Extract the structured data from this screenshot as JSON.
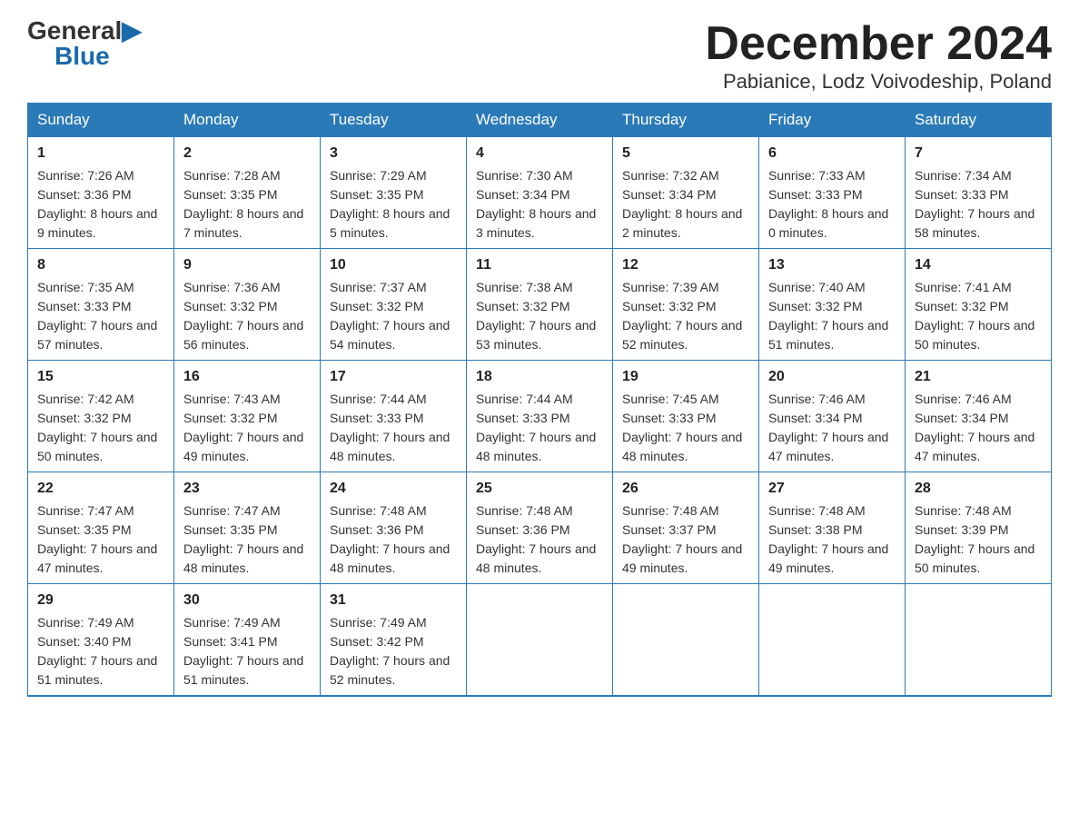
{
  "logo": {
    "general": "General",
    "blue": "Blue"
  },
  "title": "December 2024",
  "subtitle": "Pabianice, Lodz Voivodeship, Poland",
  "days": [
    "Sunday",
    "Monday",
    "Tuesday",
    "Wednesday",
    "Thursday",
    "Friday",
    "Saturday"
  ],
  "weeks": [
    [
      {
        "num": "1",
        "sunrise": "7:26 AM",
        "sunset": "3:36 PM",
        "daylight": "8 hours and 9 minutes."
      },
      {
        "num": "2",
        "sunrise": "7:28 AM",
        "sunset": "3:35 PM",
        "daylight": "8 hours and 7 minutes."
      },
      {
        "num": "3",
        "sunrise": "7:29 AM",
        "sunset": "3:35 PM",
        "daylight": "8 hours and 5 minutes."
      },
      {
        "num": "4",
        "sunrise": "7:30 AM",
        "sunset": "3:34 PM",
        "daylight": "8 hours and 3 minutes."
      },
      {
        "num": "5",
        "sunrise": "7:32 AM",
        "sunset": "3:34 PM",
        "daylight": "8 hours and 2 minutes."
      },
      {
        "num": "6",
        "sunrise": "7:33 AM",
        "sunset": "3:33 PM",
        "daylight": "8 hours and 0 minutes."
      },
      {
        "num": "7",
        "sunrise": "7:34 AM",
        "sunset": "3:33 PM",
        "daylight": "7 hours and 58 minutes."
      }
    ],
    [
      {
        "num": "8",
        "sunrise": "7:35 AM",
        "sunset": "3:33 PM",
        "daylight": "7 hours and 57 minutes."
      },
      {
        "num": "9",
        "sunrise": "7:36 AM",
        "sunset": "3:32 PM",
        "daylight": "7 hours and 56 minutes."
      },
      {
        "num": "10",
        "sunrise": "7:37 AM",
        "sunset": "3:32 PM",
        "daylight": "7 hours and 54 minutes."
      },
      {
        "num": "11",
        "sunrise": "7:38 AM",
        "sunset": "3:32 PM",
        "daylight": "7 hours and 53 minutes."
      },
      {
        "num": "12",
        "sunrise": "7:39 AM",
        "sunset": "3:32 PM",
        "daylight": "7 hours and 52 minutes."
      },
      {
        "num": "13",
        "sunrise": "7:40 AM",
        "sunset": "3:32 PM",
        "daylight": "7 hours and 51 minutes."
      },
      {
        "num": "14",
        "sunrise": "7:41 AM",
        "sunset": "3:32 PM",
        "daylight": "7 hours and 50 minutes."
      }
    ],
    [
      {
        "num": "15",
        "sunrise": "7:42 AM",
        "sunset": "3:32 PM",
        "daylight": "7 hours and 50 minutes."
      },
      {
        "num": "16",
        "sunrise": "7:43 AM",
        "sunset": "3:32 PM",
        "daylight": "7 hours and 49 minutes."
      },
      {
        "num": "17",
        "sunrise": "7:44 AM",
        "sunset": "3:33 PM",
        "daylight": "7 hours and 48 minutes."
      },
      {
        "num": "18",
        "sunrise": "7:44 AM",
        "sunset": "3:33 PM",
        "daylight": "7 hours and 48 minutes."
      },
      {
        "num": "19",
        "sunrise": "7:45 AM",
        "sunset": "3:33 PM",
        "daylight": "7 hours and 48 minutes."
      },
      {
        "num": "20",
        "sunrise": "7:46 AM",
        "sunset": "3:34 PM",
        "daylight": "7 hours and 47 minutes."
      },
      {
        "num": "21",
        "sunrise": "7:46 AM",
        "sunset": "3:34 PM",
        "daylight": "7 hours and 47 minutes."
      }
    ],
    [
      {
        "num": "22",
        "sunrise": "7:47 AM",
        "sunset": "3:35 PM",
        "daylight": "7 hours and 47 minutes."
      },
      {
        "num": "23",
        "sunrise": "7:47 AM",
        "sunset": "3:35 PM",
        "daylight": "7 hours and 48 minutes."
      },
      {
        "num": "24",
        "sunrise": "7:48 AM",
        "sunset": "3:36 PM",
        "daylight": "7 hours and 48 minutes."
      },
      {
        "num": "25",
        "sunrise": "7:48 AM",
        "sunset": "3:36 PM",
        "daylight": "7 hours and 48 minutes."
      },
      {
        "num": "26",
        "sunrise": "7:48 AM",
        "sunset": "3:37 PM",
        "daylight": "7 hours and 49 minutes."
      },
      {
        "num": "27",
        "sunrise": "7:48 AM",
        "sunset": "3:38 PM",
        "daylight": "7 hours and 49 minutes."
      },
      {
        "num": "28",
        "sunrise": "7:48 AM",
        "sunset": "3:39 PM",
        "daylight": "7 hours and 50 minutes."
      }
    ],
    [
      {
        "num": "29",
        "sunrise": "7:49 AM",
        "sunset": "3:40 PM",
        "daylight": "7 hours and 51 minutes."
      },
      {
        "num": "30",
        "sunrise": "7:49 AM",
        "sunset": "3:41 PM",
        "daylight": "7 hours and 51 minutes."
      },
      {
        "num": "31",
        "sunrise": "7:49 AM",
        "sunset": "3:42 PM",
        "daylight": "7 hours and 52 minutes."
      },
      null,
      null,
      null,
      null
    ]
  ]
}
